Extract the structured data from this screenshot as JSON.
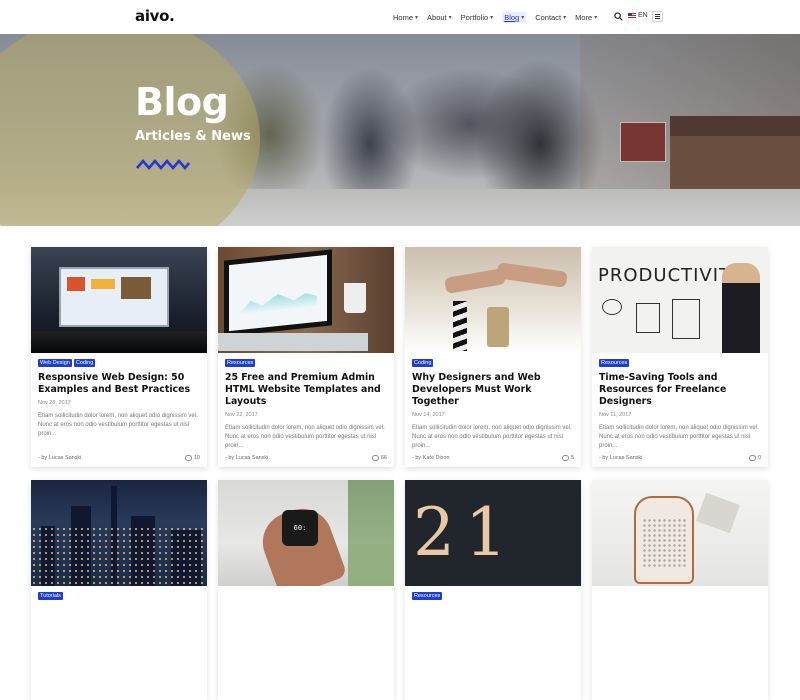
{
  "header": {
    "logo": "aivo.",
    "nav": [
      {
        "label": "Home",
        "active": false
      },
      {
        "label": "About",
        "active": false
      },
      {
        "label": "Portfolio",
        "active": false
      },
      {
        "label": "Blog",
        "active": true
      },
      {
        "label": "Contact",
        "active": false
      },
      {
        "label": "More",
        "active": false
      }
    ],
    "language": "EN"
  },
  "hero": {
    "title": "Blog",
    "subtitle": "Articles & News",
    "accent_color": "#2438d6"
  },
  "posts": [
    {
      "tags": [
        "Web Design",
        "Coding"
      ],
      "title": "Responsive Web Design: 50 Examples and Best Practices",
      "date": "Nov 28, 2017",
      "excerpt": "Etiam sollicitudin dolor lorem, non aliquet odio dignissim vel. Nunc at eros non odio vestibulum porttitor egestas ut nisl proin...",
      "author": "- by Lucas Sanski",
      "comments": "10"
    },
    {
      "tags": [
        "Resources"
      ],
      "title": "25 Free and Premium Admin HTML Website Templates and Layouts",
      "date": "Nov 22, 2017",
      "excerpt": "Etiam sollicitudin dolor lorem, non aliquet odio dignissim vel. Nunc at eros non odio vestibulum porttitor egestas ut nisl proin...",
      "author": "- by Lucas Sanski",
      "comments": "66"
    },
    {
      "tags": [
        "Coding"
      ],
      "title": "Why Designers and Web Developers Must Work Together",
      "date": "Nov 14, 2017",
      "excerpt": "Etiam sollicitudin dolor lorem, non aliquet odio dignissim vel. Nunc at eros non odio vestibulum porttitor egestas ut nisl proin...",
      "author": "- by Kate Dixon",
      "comments": "5"
    },
    {
      "tags": [
        "Resources"
      ],
      "title": "Time-Saving Tools and Resources for Freelance Designers",
      "date": "Nov 11, 2017",
      "excerpt": "Etiam sollicitudin dolor lorem, non aliquet odio dignissim vel. Nunc at eros non odio vestibulum porttitor egestas ut nisl proin...",
      "author": "- by Lucas Sanski",
      "comments": "0"
    },
    {
      "tags": [
        "Tutorials"
      ]
    },
    {
      "tags": []
    },
    {
      "tags": [
        "Resources"
      ]
    },
    {
      "tags": []
    }
  ],
  "images": {
    "productivity_word": "PRODUCTIVITY",
    "stopwatch_text": "60:",
    "number_text": "21"
  },
  "icons": {
    "search": "search-icon",
    "menu": "menu-icon",
    "comments": "comment-icon",
    "flag": "uk-flag-icon"
  }
}
